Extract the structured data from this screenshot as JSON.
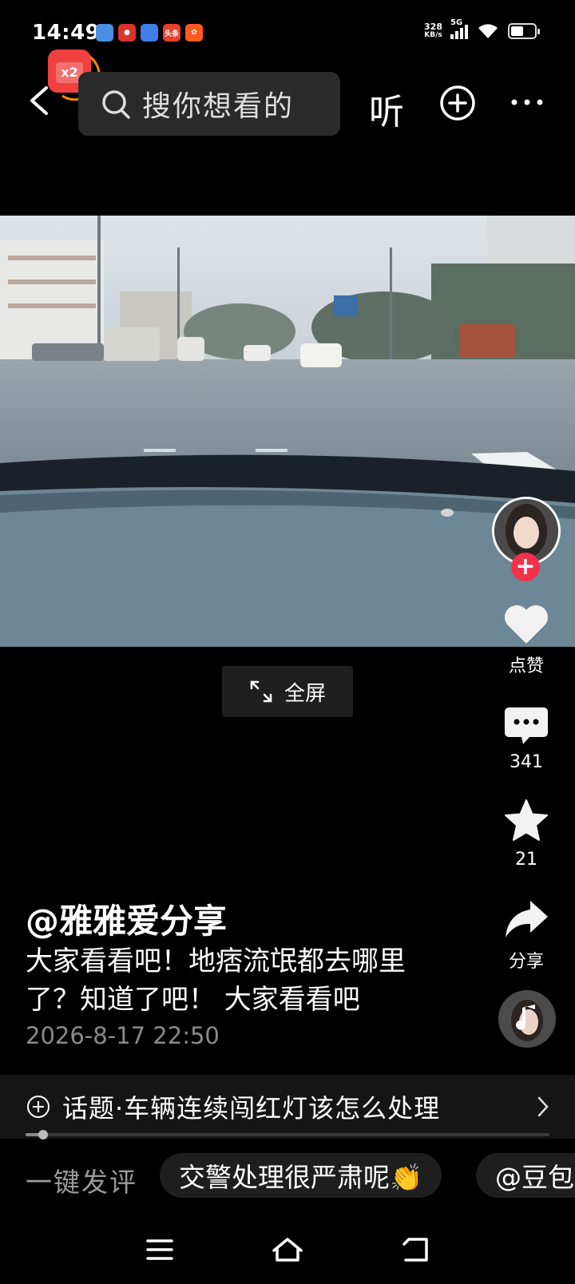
{
  "status_bar": {
    "time": "14:49",
    "net_speed": "328",
    "net_unit": "KB/s",
    "network": "5G",
    "battery_level": 0.55,
    "app_icons": [
      "cloud-app-icon",
      "game-app-icon",
      "browser-app-icon",
      "toutiao-app-icon",
      "kuaishou-app-icon"
    ],
    "toutiao_label": "头条"
  },
  "top_bar": {
    "search_placeholder": "搜你想看的",
    "listen_label": "听",
    "badge_label": "x2"
  },
  "video": {
    "fullscreen_label": "全屏"
  },
  "rail": {
    "like_label": "点赞",
    "comment_count": "341",
    "favorite_count": "21",
    "share_label": "分享"
  },
  "post": {
    "author": "@雅雅爱分享",
    "description": "大家看看吧！地痞流氓都去哪里了？知道了吧！ 大家看看吧",
    "date": "2026-8-17 22:50"
  },
  "topic": {
    "text": "话题·车辆连续闯红灯该怎么处理"
  },
  "progress": 0.03,
  "quick_comment": {
    "label": "一键发评",
    "chips": [
      "交警处理很严肃呢👏",
      "@豆包"
    ]
  },
  "colors": {
    "accent_red": "#f2324a",
    "search_bg": "#2a2a2a",
    "badge_ring": "#ff8a00"
  }
}
